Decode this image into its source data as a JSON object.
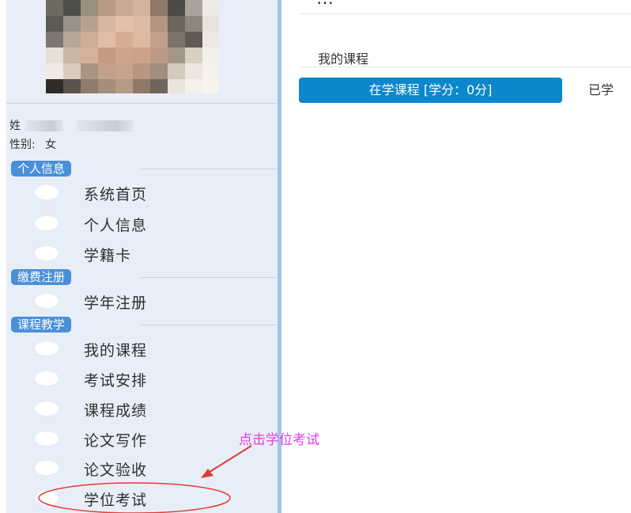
{
  "profile": {
    "name_label": "姓",
    "gender_label": "性别:",
    "gender_value": "女"
  },
  "sidebar": {
    "sections": [
      {
        "label": "个人信息",
        "items": [
          "系统首页",
          "个人信息",
          "学籍卡"
        ]
      },
      {
        "label": "缴费注册",
        "items": [
          "学年注册"
        ]
      },
      {
        "label": "课程教学",
        "items": [
          "我的课程",
          "考试安排",
          "课程成绩",
          "论文写作",
          "论文验收",
          "学位考试"
        ]
      }
    ]
  },
  "main": {
    "page_title_partial": "…",
    "breadcrumb": "我的课程",
    "tabs": {
      "active": "在学课程 [学分：0分]",
      "inactive": "已学"
    }
  },
  "annotation": {
    "text": "点击学位考试",
    "color": "#e43be8",
    "arrow_color": "#e53935"
  },
  "colors": {
    "sidebar_bg": "#e8eef8",
    "sidebar_border": "#a3c4ea",
    "section_badge": "#4a90d8",
    "tab_active": "#0b87cd"
  }
}
